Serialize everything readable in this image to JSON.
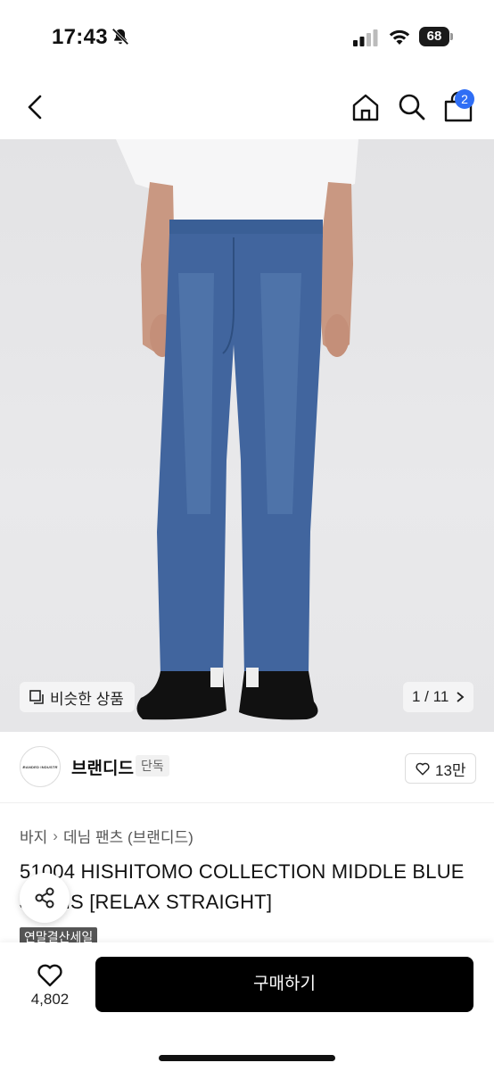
{
  "status_bar": {
    "time": "17:43",
    "battery": "68",
    "icons": [
      "bell-slash-icon",
      "signal-icon",
      "wifi-icon",
      "battery-icon"
    ]
  },
  "nav": {
    "back_icon": "chevron-left-icon",
    "home_icon": "home-icon",
    "search_icon": "search-icon",
    "cart_icon": "shopping-bag-icon",
    "cart_count": "2",
    "accent_color": "#2f6ef5"
  },
  "gallery": {
    "similar_label": "비슷한 상품",
    "pager_text": "1 / 11",
    "pager_icon": "chevron-right-icon"
  },
  "brand": {
    "logo_text": "BRANDED INDUSTRY",
    "name": "브랜디드",
    "tag": "단독",
    "likes": "13만"
  },
  "breadcrumb": {
    "items": [
      "바지",
      "데님 팬츠 (브랜디드)"
    ],
    "separator": "›"
  },
  "product": {
    "title": "51004 HISHITOMO COLLECTION MIDDLE BLUE JEANS [RELAX STRAIGHT]",
    "sale_tag": "연말결산세일"
  },
  "bottom_bar": {
    "wish_count": "4,802",
    "buy_label": "구매하기",
    "buy_color": "#000000"
  }
}
